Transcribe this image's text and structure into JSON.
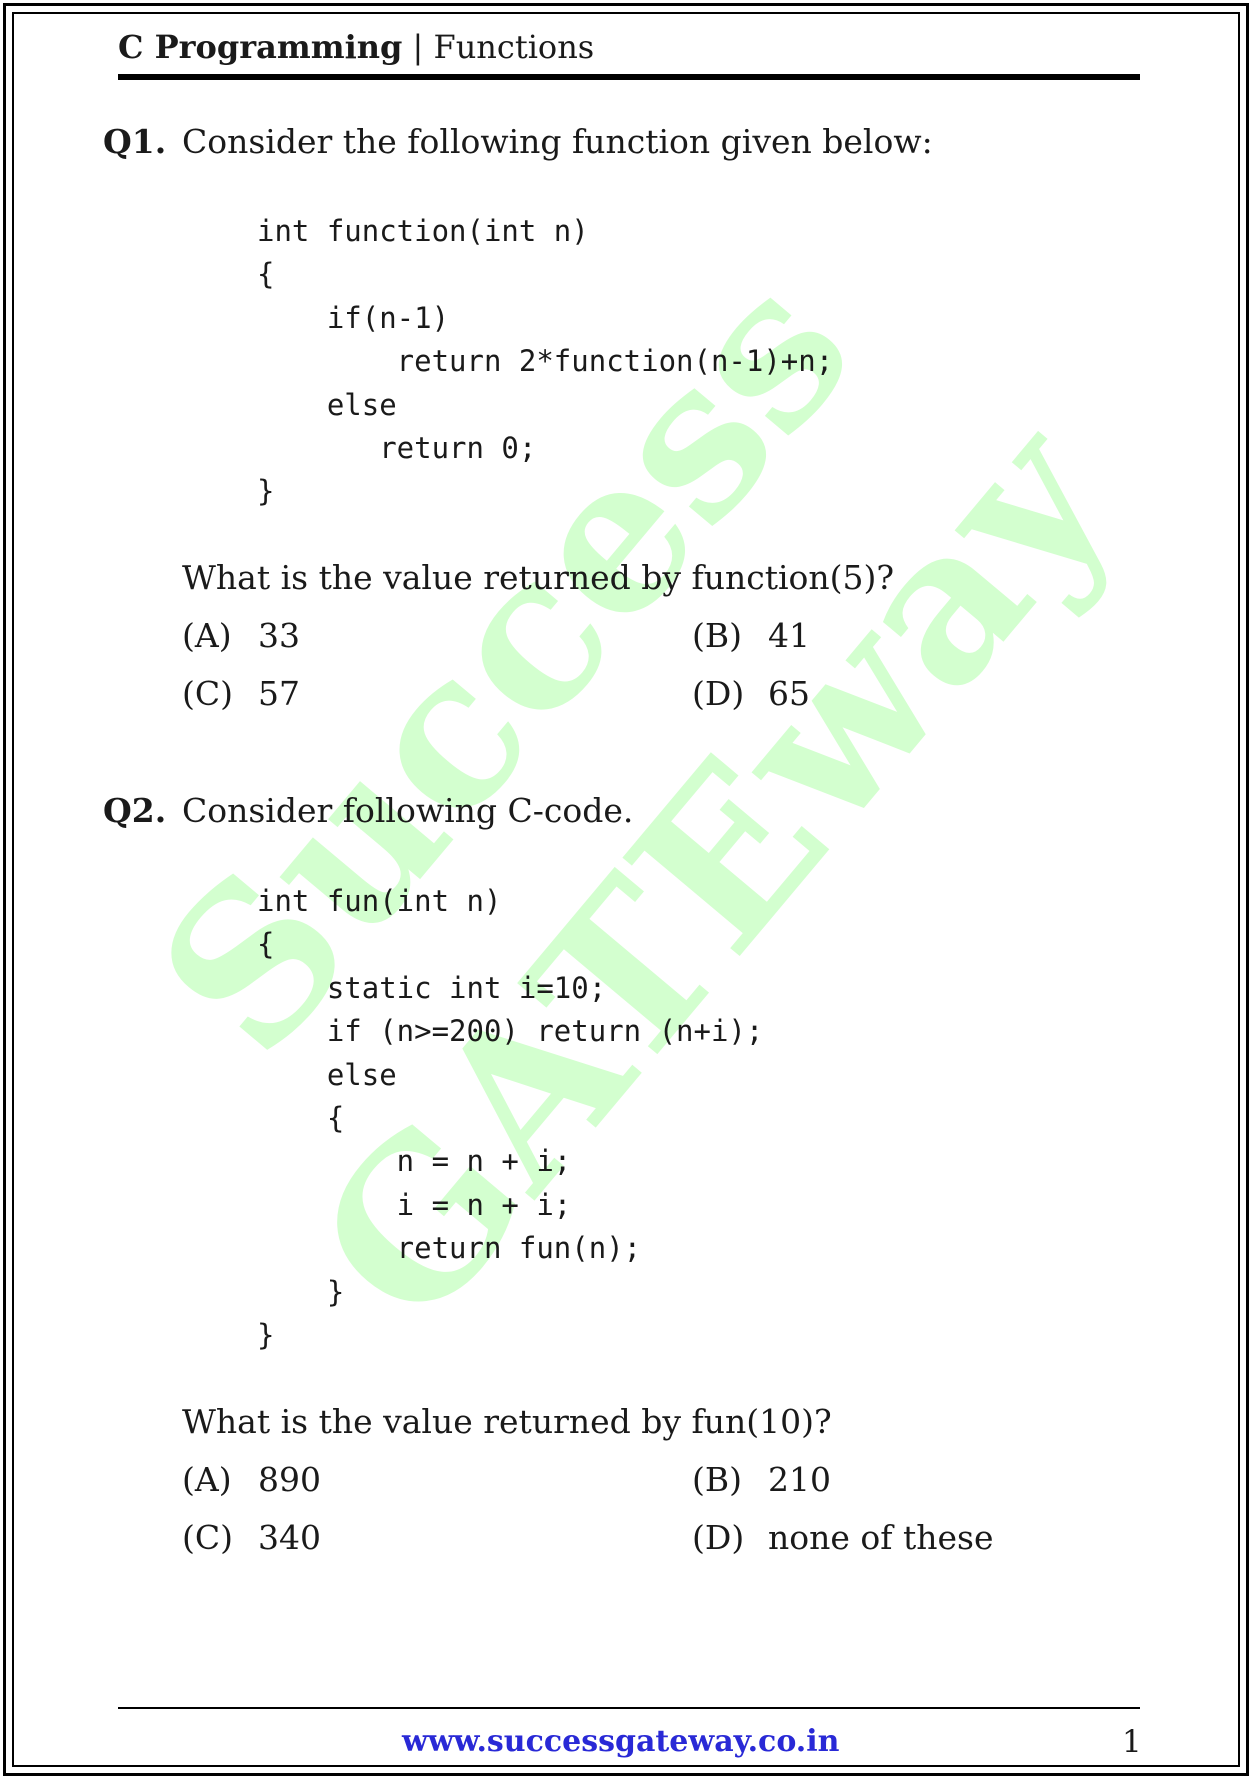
{
  "header": {
    "subject": "C Programming",
    "separator": "|",
    "topic": "Functions"
  },
  "watermark": {
    "line1": "Success",
    "line2": "GATEway",
    "color": "#7cff6e"
  },
  "questions": [
    {
      "number": "Q1.",
      "prompt": "Consider the following function given below:",
      "code": "int function(int n)\n{\n    if(n-1)\n        return 2*function(n-1)+n;\n    else\n       return 0;\n}",
      "question": "What is the value returned by function(5)?",
      "options": [
        {
          "label": "(A)",
          "text": "33"
        },
        {
          "label": "(B)",
          "text": "41"
        },
        {
          "label": "(C)",
          "text": "57"
        },
        {
          "label": "(D)",
          "text": "65"
        }
      ]
    },
    {
      "number": "Q2.",
      "prompt": "Consider following C-code.",
      "code": "int fun(int n)\n{\n    static int i=10;\n    if (n>=200) return (n+i);\n    else\n    {\n        n = n + i;\n        i = n + i;\n        return fun(n);\n    }\n}",
      "question": "What is the value returned by fun(10)?",
      "options": [
        {
          "label": "(A)",
          "text": "890"
        },
        {
          "label": "(B)",
          "text": "210"
        },
        {
          "label": "(C)",
          "text": "340"
        },
        {
          "label": "(D)",
          "text": "none of these"
        }
      ]
    }
  ],
  "footer": {
    "url": "www.successgateway.co.in",
    "page_number": "1",
    "url_color": "#2929d6"
  }
}
